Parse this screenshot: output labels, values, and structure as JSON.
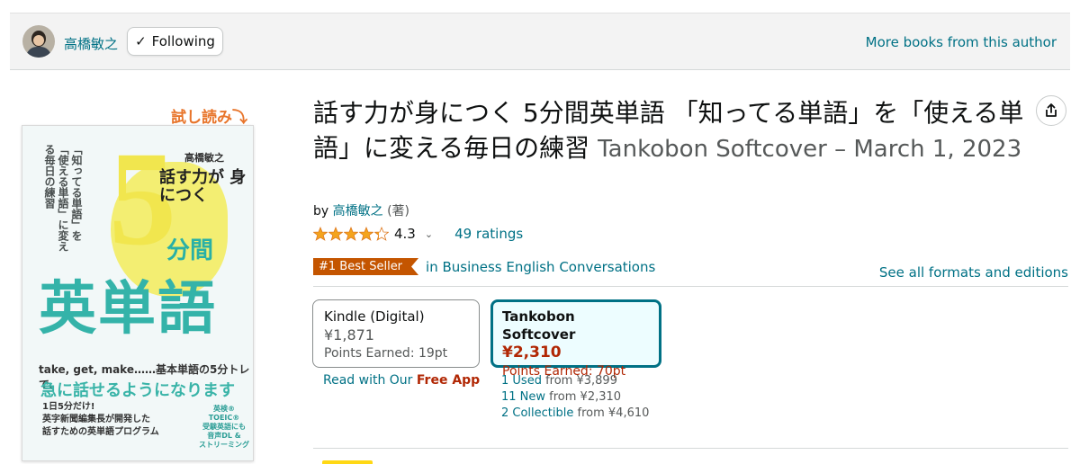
{
  "author_bar": {
    "name": "高橋敏之",
    "follow_label": "Following",
    "follow_check": "✓",
    "more_books": "More books from this author"
  },
  "cover": {
    "try_read": "試し読み⤵",
    "vertical_text": "「知ってる単語」を「使える単語」に変える毎日の練習",
    "author": "高橋敏之",
    "subtitle": "話す力が 身につく",
    "five": "5",
    "fun": "分間",
    "main": "英単語",
    "tagline": "take, get, make……基本単語の5分トレで、",
    "big_line": "急に話せるようになります",
    "lines": [
      "1日5分だけ!",
      "英字新聞編集長が開発した",
      "話すための英単語プログラム"
    ],
    "side": [
      "英検®",
      "TOEIC®",
      "受験英語にも",
      "音声DL &",
      "ストリーミング"
    ]
  },
  "product": {
    "title": "話す力が身につく 5分間英単語 「知ってる単語」を「使える単語」に変える毎日の練習",
    "binding": "Tankobon Softcover – March 1, 2023",
    "by": "by",
    "author_link": "高橋敏之",
    "author_role": "(著)",
    "rating": "4.3",
    "rating_stars": 4.3,
    "rating_count": "49 ratings",
    "bestseller_badge": "#1 Best Seller",
    "bestseller_category": "in Business English Conversations",
    "see_formats": "See all formats and editions"
  },
  "formats": {
    "kindle": {
      "name": "Kindle (Digital)",
      "price": "¥1,871",
      "points": "Points Earned: 19pt",
      "read_with": "Read with Our",
      "free_app": "Free App"
    },
    "tankobon": {
      "name": "Tankobon Softcover",
      "price": "¥2,310",
      "points": "Points Earned: 70pt",
      "offers": [
        {
          "link": "1 Used",
          "from": "from ¥3,899"
        },
        {
          "link": "11 New",
          "from": "from ¥2,310"
        },
        {
          "link": "2 Collectible",
          "from": "from ¥4,610"
        }
      ]
    }
  },
  "colors": {
    "link": "#007185",
    "price_red": "#b12704",
    "badge": "#c45500",
    "star": "#f4a41d"
  }
}
